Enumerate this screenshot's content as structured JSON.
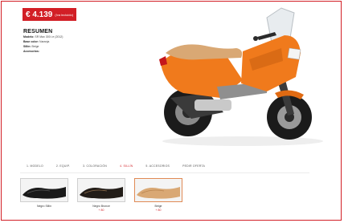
{
  "price": {
    "value": "€ 4.139",
    "note": "(Iva incluido)"
  },
  "summary": {
    "title": "RESUMEN",
    "rows": [
      {
        "label": "Modelo:",
        "value": "SR Max 300 i.e (2012)"
      },
      {
        "label": "Base color:",
        "value": "Naranja"
      },
      {
        "label": "Sillín:",
        "value": "Beige"
      },
      {
        "label": "Accesorios:",
        "value": ""
      }
    ]
  },
  "steps": [
    {
      "label": "1. MODELO"
    },
    {
      "label": "2. EQUIP."
    },
    {
      "label": "3. COLORACIÓN"
    },
    {
      "label": "4. SILLÍN"
    },
    {
      "label": "5. ACCESORIOS"
    },
    {
      "label": "PEDIR OFERTA"
    }
  ],
  "active_step": 3,
  "seats": [
    {
      "name": "Negro Sillín",
      "price": ""
    },
    {
      "name": "Negro Bronce",
      "price": "+ 80"
    },
    {
      "name": "Beige",
      "price": "+ 80"
    }
  ],
  "colors": {
    "accent": "#d21f26",
    "body_orange": "#f07a1c",
    "seat_beige": "#d9a874"
  }
}
